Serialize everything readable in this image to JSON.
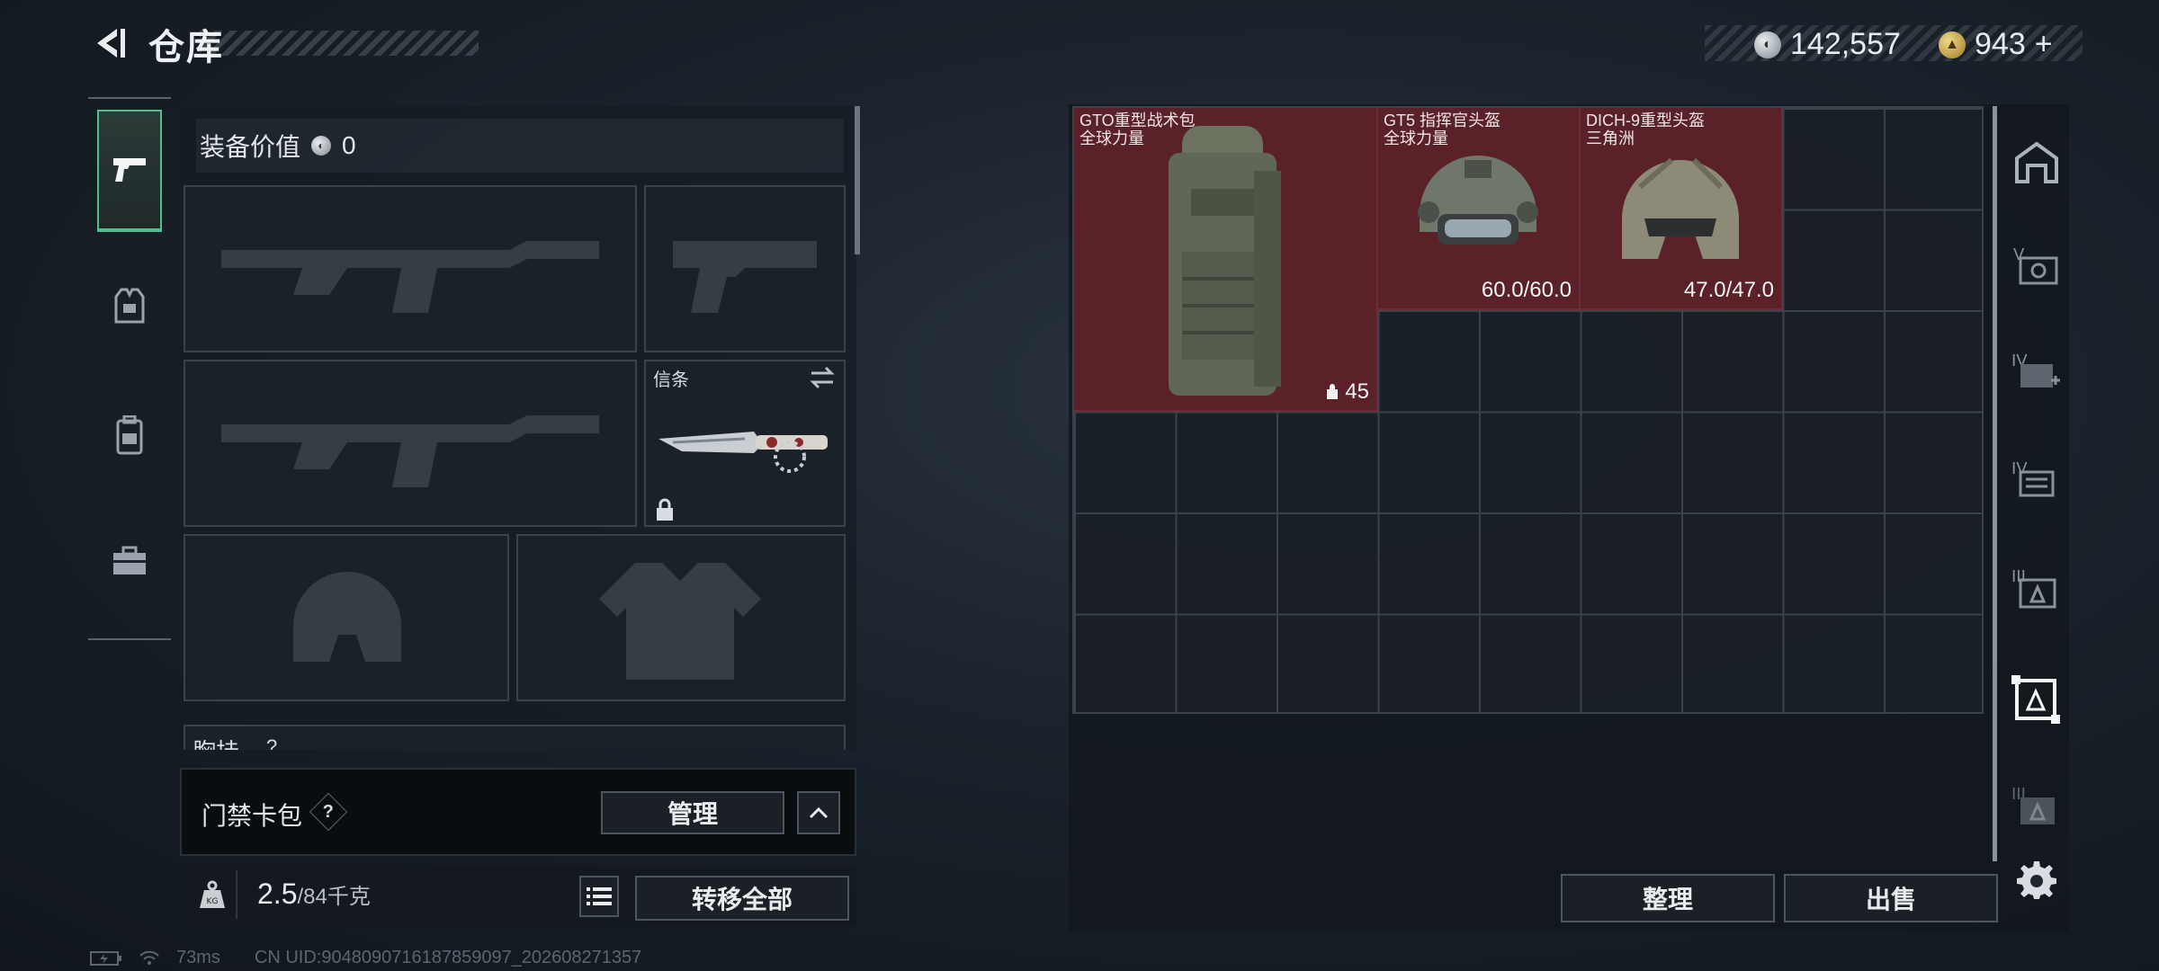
{
  "header": {
    "title": "仓库",
    "silver_amount": "142,557",
    "gold_amount": "943",
    "gold_add": "+"
  },
  "loadout": {
    "equipment_value_label": "装备价值",
    "equipment_value": "0",
    "melee_slot_label": "信条",
    "chest_rig_label": "胸挂",
    "chest_rig_hint": "?"
  },
  "keycard": {
    "label": "门禁卡包",
    "help": "?",
    "manage_label": "管理"
  },
  "weight": {
    "current": "2.5",
    "capacity": "/84千克",
    "transfer_all_label": "转移全部"
  },
  "storage": {
    "items": [
      {
        "name": "GTO重型战术包",
        "sub": "全球力量",
        "stat": "45"
      },
      {
        "name": "GT5 指挥官头盔",
        "sub": "全球力量",
        "stat": "60.0/60.0"
      },
      {
        "name": "DICH-9重型头盔",
        "sub": "三角洲",
        "stat": "47.0/47.0"
      }
    ],
    "sort_label": "整理",
    "sell_label": "出售"
  },
  "status_bar": {
    "ping": "73ms",
    "uid": "CN UID:9048090716187859097_202608271357"
  },
  "colors": {
    "accent_green": "#4fbf8e",
    "item_red": "#5a2129"
  }
}
